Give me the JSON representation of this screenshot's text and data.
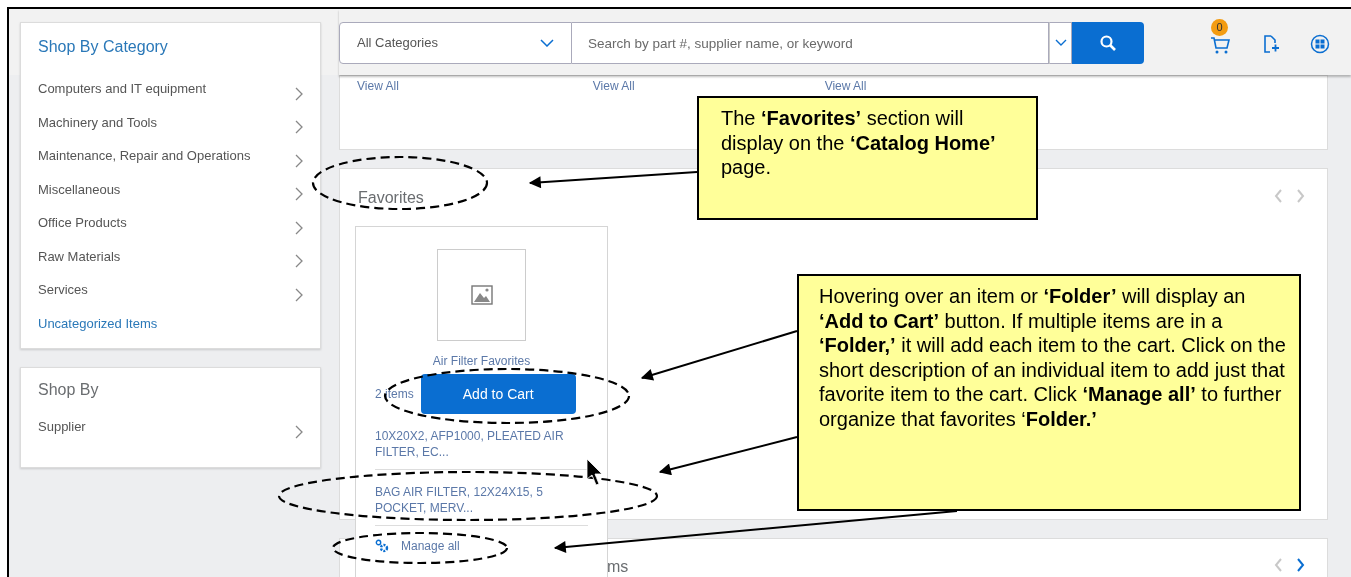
{
  "header": {
    "category_select": "All Categories",
    "search": {
      "placeholder": "Search by part #, supplier name, or keyword"
    },
    "cart_count": "0"
  },
  "shop_by_category": {
    "title": "Shop By Category",
    "items": [
      {
        "label": "Computers and IT equipment",
        "kind": "category"
      },
      {
        "label": "Machinery and Tools",
        "kind": "category"
      },
      {
        "label": "Maintenance, Repair and Operations",
        "kind": "category"
      },
      {
        "label": "Miscellaneous",
        "kind": "category"
      },
      {
        "label": "Office Products",
        "kind": "category"
      },
      {
        "label": "Raw Materials",
        "kind": "category"
      },
      {
        "label": "Services",
        "kind": "category"
      },
      {
        "label": "Uncategorized Items",
        "kind": "link"
      }
    ]
  },
  "shop_by": {
    "title": "Shop By",
    "items": [
      {
        "label": "Supplier",
        "kind": "category"
      }
    ]
  },
  "top_section": {
    "links": [
      "View All",
      "View All",
      "View All"
    ]
  },
  "favorites": {
    "title": "Favorites",
    "pager": [
      {
        "kind": "prev",
        "disabled": true
      },
      {
        "kind": "next",
        "disabled": true
      }
    ],
    "folder": {
      "name": "Air Filter Favorites",
      "count": "2 items",
      "add_button": "Add to Cart",
      "items": [
        "10X20X2, AFP1000, PLEATED AIR FILTER, EC...",
        "BAG AIR FILTER, 12X24X15, 5 POCKET, MERV..."
      ],
      "manage": "Manage all"
    }
  },
  "next_section": {
    "title": "ms",
    "pager": [
      {
        "kind": "prev",
        "disabled": true
      },
      {
        "kind": "next",
        "disabled": false
      }
    ]
  },
  "callouts": [
    {
      "text": "The **‘Favorites’** section will display on the **‘Catalog Home’** page."
    },
    {
      "text": "Hovering over an item or **‘Folder’** will display an **‘Add to Cart’** button.  If multiple items are in a **‘Folder,’** it will add each item to the cart.  Click on the short description of an individual item to add just that favorite item to the cart.  Click **‘Manage all’** to further organize that favorites ‘**Folder.’**"
    }
  ]
}
